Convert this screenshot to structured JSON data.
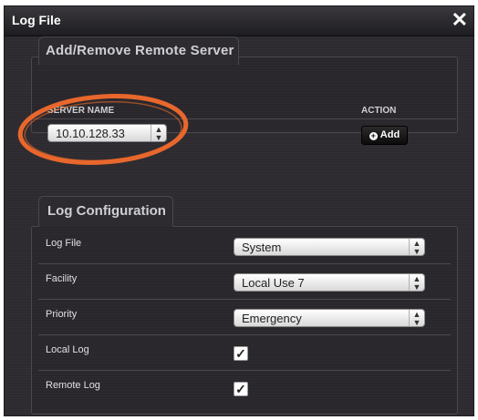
{
  "window": {
    "title": "Log File",
    "close_glyph": "✕"
  },
  "remote_server": {
    "tab_label": "Add/Remove Remote Server",
    "col_server_name": "SERVER NAME",
    "col_action": "ACTION",
    "server_value": "10.10.128.33",
    "add_label": "Add",
    "highlight_color": "#e8672c"
  },
  "log_config": {
    "tab_label": "Log Configuration",
    "rows": [
      {
        "label": "Log File",
        "type": "select",
        "value": "System"
      },
      {
        "label": "Facility",
        "type": "select",
        "value": "Local Use 7"
      },
      {
        "label": "Priority",
        "type": "select",
        "value": "Emergency"
      },
      {
        "label": "Local Log",
        "type": "checkbox",
        "checked": true
      },
      {
        "label": "Remote Log",
        "type": "checkbox",
        "checked": true
      }
    ]
  },
  "icons": {
    "select_arrows": "updown-arrows-icon",
    "close": "close-icon",
    "add": "plus-circle-icon"
  }
}
